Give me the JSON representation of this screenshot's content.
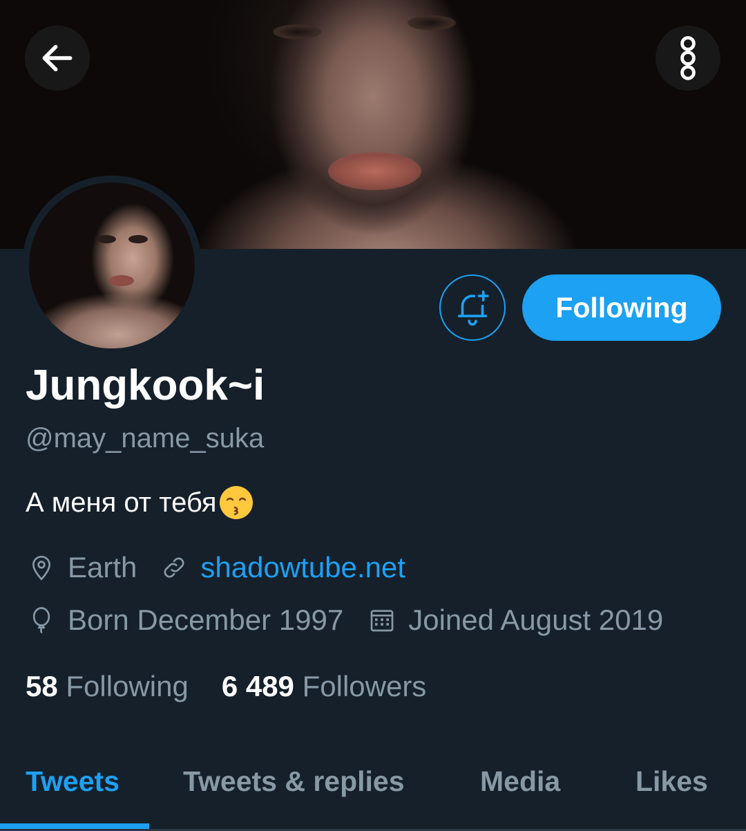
{
  "header": {
    "back_icon": "arrow-left-icon",
    "more_icon": "vertical-dots-icon"
  },
  "actions": {
    "notify_icon": "bell-plus-icon",
    "follow_label": "Following",
    "accent_color": "#1da1f2"
  },
  "profile": {
    "display_name": "Jungkook~i",
    "handle": "@may_name_suka",
    "bio": "А меня от тебя",
    "bio_emoji": "kissing-face-emoji",
    "location": "Earth",
    "website": "shadowtube.net",
    "birthday": "Born December 1997",
    "joined": "Joined August 2019"
  },
  "stats": {
    "following_count": "58",
    "following_label": "Following",
    "followers_count": "6 489",
    "followers_label": "Followers"
  },
  "tabs": [
    {
      "label": "Tweets",
      "active": true
    },
    {
      "label": "Tweets & replies",
      "active": false
    },
    {
      "label": "Media",
      "active": false
    },
    {
      "label": "Likes",
      "active": false
    }
  ],
  "colors": {
    "background": "#15202b",
    "secondary_text": "#8899a6",
    "primary_text": "#ffffff"
  }
}
